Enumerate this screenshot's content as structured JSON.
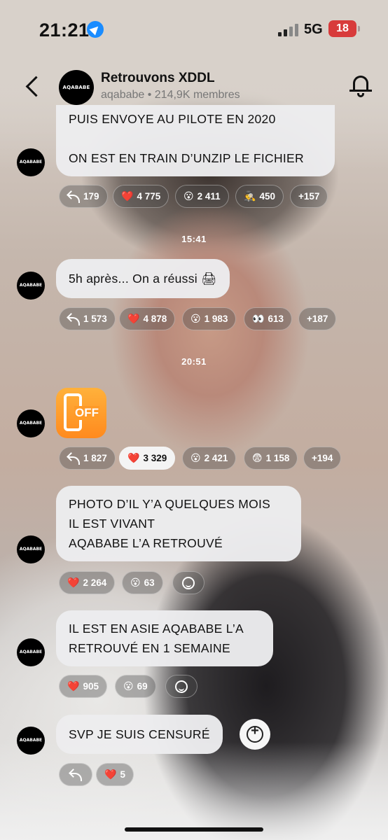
{
  "status_bar": {
    "time": "21:21",
    "network": "5G",
    "battery": "18"
  },
  "header": {
    "title": "Retrouvons XDDL",
    "subtitle": "aqababe • 214,9K membres",
    "avatar_text": "AQABABE"
  },
  "messages": [
    {
      "lines": [
        "PUIS ENVOYE AU PILOTE EN 2020",
        "",
        "ON EST EN TRAIN D’UNZIP LE FICHIER"
      ],
      "reactions": [
        {
          "emoji": "",
          "count": "179"
        },
        {
          "emoji": "❤️",
          "count": "4 775"
        },
        {
          "emoji": "😮",
          "count": "2 411"
        },
        {
          "emoji": "🕵",
          "count": "450"
        },
        {
          "emoji": "",
          "count": "+157"
        }
      ]
    },
    {
      "timestamp": "15:41",
      "lines": [
        "5h après... On a réussi 🖨"
      ],
      "reactions": [
        {
          "emoji": "",
          "count": "1 573"
        },
        {
          "emoji": "❤️",
          "count": "4 878"
        },
        {
          "emoji": "😮",
          "count": "1 983"
        },
        {
          "emoji": "👀",
          "count": "613"
        },
        {
          "emoji": "",
          "count": "+187"
        }
      ]
    },
    {
      "timestamp": "20:51",
      "emoji_label": "OFF",
      "reactions": [
        {
          "emoji": "",
          "count": "1 827"
        },
        {
          "emoji": "❤️",
          "count": "3 329"
        },
        {
          "emoji": "😮",
          "count": "2 421"
        },
        {
          "emoji": "😨",
          "count": "1 158"
        },
        {
          "emoji": "",
          "count": "+194"
        }
      ]
    },
    {
      "lines": [
        "PHOTO D’IL Y’A QUELQUES MOIS",
        "IL EST VIVANT",
        "AQABABE L’A RETROUVÉ"
      ],
      "reactions": [
        {
          "emoji": "❤️",
          "count": "2 264"
        },
        {
          "emoji": "😮",
          "count": "63"
        }
      ]
    },
    {
      "lines": [
        "IL EST EN ASIE AQABABE L’A",
        "RETROUVÉ EN 1 SEMAINE"
      ],
      "reactions": [
        {
          "emoji": "❤️",
          "count": "905"
        },
        {
          "emoji": "😮",
          "count": "69"
        }
      ]
    },
    {
      "lines": [
        "SVP JE SUIS CENSURÉ"
      ],
      "reactions": [
        {
          "emoji": "❤️",
          "count": "5"
        }
      ]
    }
  ]
}
